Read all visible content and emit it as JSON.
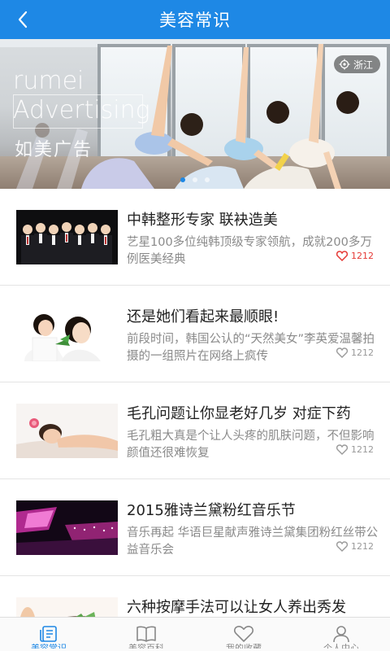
{
  "header": {
    "title": "美容常识"
  },
  "banner": {
    "brand_en": "rumei\nAdvertising",
    "brand_en_line1": "rumei",
    "brand_en_line2": "Advertising",
    "brand_cn": "如美广告",
    "location": "浙江",
    "page_count": 3,
    "active_page": 1
  },
  "articles": [
    {
      "title": "中韩整形专家 联袂造美",
      "desc": "艺星100多位纯韩顶级专家领航，成就200多万例医美经典",
      "likes": "1212",
      "liked": true,
      "thumb": "doctors"
    },
    {
      "title": "还是她们看起来最顺眼!",
      "desc": "前段时间，韩国公认的“天然美女”李英爱温馨拍摄的一组照片在网络上疯传",
      "likes": "1212",
      "liked": false,
      "thumb": "mother-child"
    },
    {
      "title": "毛孔问题让你显老好几岁 对症下药",
      "desc": "毛孔粗大真是个让人头疼的肌肤问题，不但影响颜值还很难恢复",
      "likes": "1212",
      "liked": false,
      "thumb": "spa"
    },
    {
      "title": "2015雅诗兰黛粉红音乐节",
      "desc": "音乐再起 华语巨星献声雅诗兰黛集团粉红丝带公益音乐会",
      "likes": "1212",
      "liked": false,
      "thumb": "concert"
    },
    {
      "title": "六种按摩手法可以让女人养出秀发",
      "desc": "",
      "likes": "",
      "liked": false,
      "thumb": "massage"
    }
  ],
  "tabs": [
    {
      "label": "美容常识",
      "icon": "article-icon",
      "active": true
    },
    {
      "label": "美容百科",
      "icon": "book-icon",
      "active": false
    },
    {
      "label": "我的收藏",
      "icon": "heart-icon",
      "active": false
    },
    {
      "label": "个人中心",
      "icon": "user-icon",
      "active": false
    }
  ],
  "colors": {
    "primary": "#1e88e5",
    "liked": "#e53935"
  }
}
